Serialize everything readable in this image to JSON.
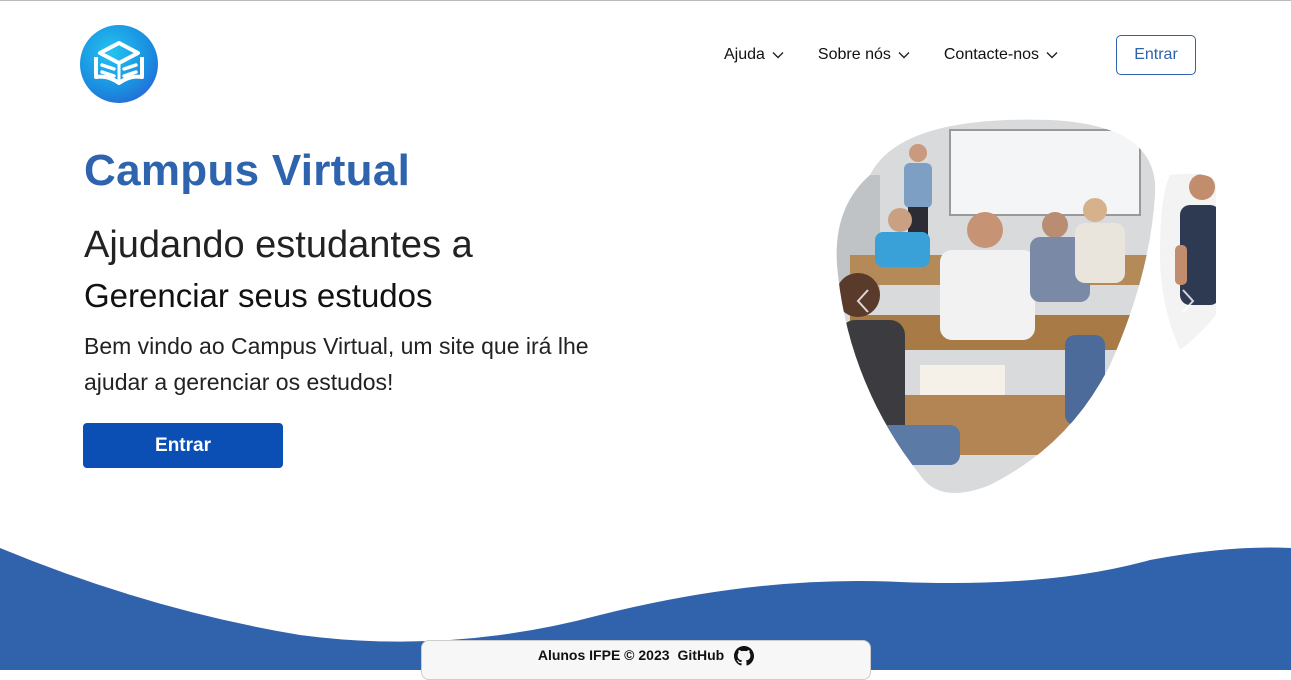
{
  "header": {
    "logo_icon": "book-logo-icon",
    "nav": [
      {
        "label": "Ajuda",
        "icon": "chevron-down-icon"
      },
      {
        "label": "Sobre nós",
        "icon": "chevron-down-icon"
      },
      {
        "label": "Contacte-nos",
        "icon": "chevron-down-icon"
      }
    ],
    "login_label": "Entrar"
  },
  "hero": {
    "title": "Campus Virtual",
    "subtitle_1": "Ajudando estudantes a",
    "subtitle_2": "Gerenciar seus estudos",
    "description": "Bem vindo ao Campus Virtual, um site que irá lhe ajudar a gerenciar os estudos!",
    "cta_label": "Entrar"
  },
  "carousel": {
    "image": "classroom-students-photo",
    "prev_icon": "chevron-left-icon",
    "next_icon": "chevron-right-icon"
  },
  "footer": {
    "text": "Alunos IFPE © 2023",
    "link_label": "GitHub",
    "link_icon": "github-icon"
  },
  "colors": {
    "brand_blue": "#2e63ad",
    "button_blue": "#0b4fb5",
    "wave_blue": "#3163ac"
  }
}
